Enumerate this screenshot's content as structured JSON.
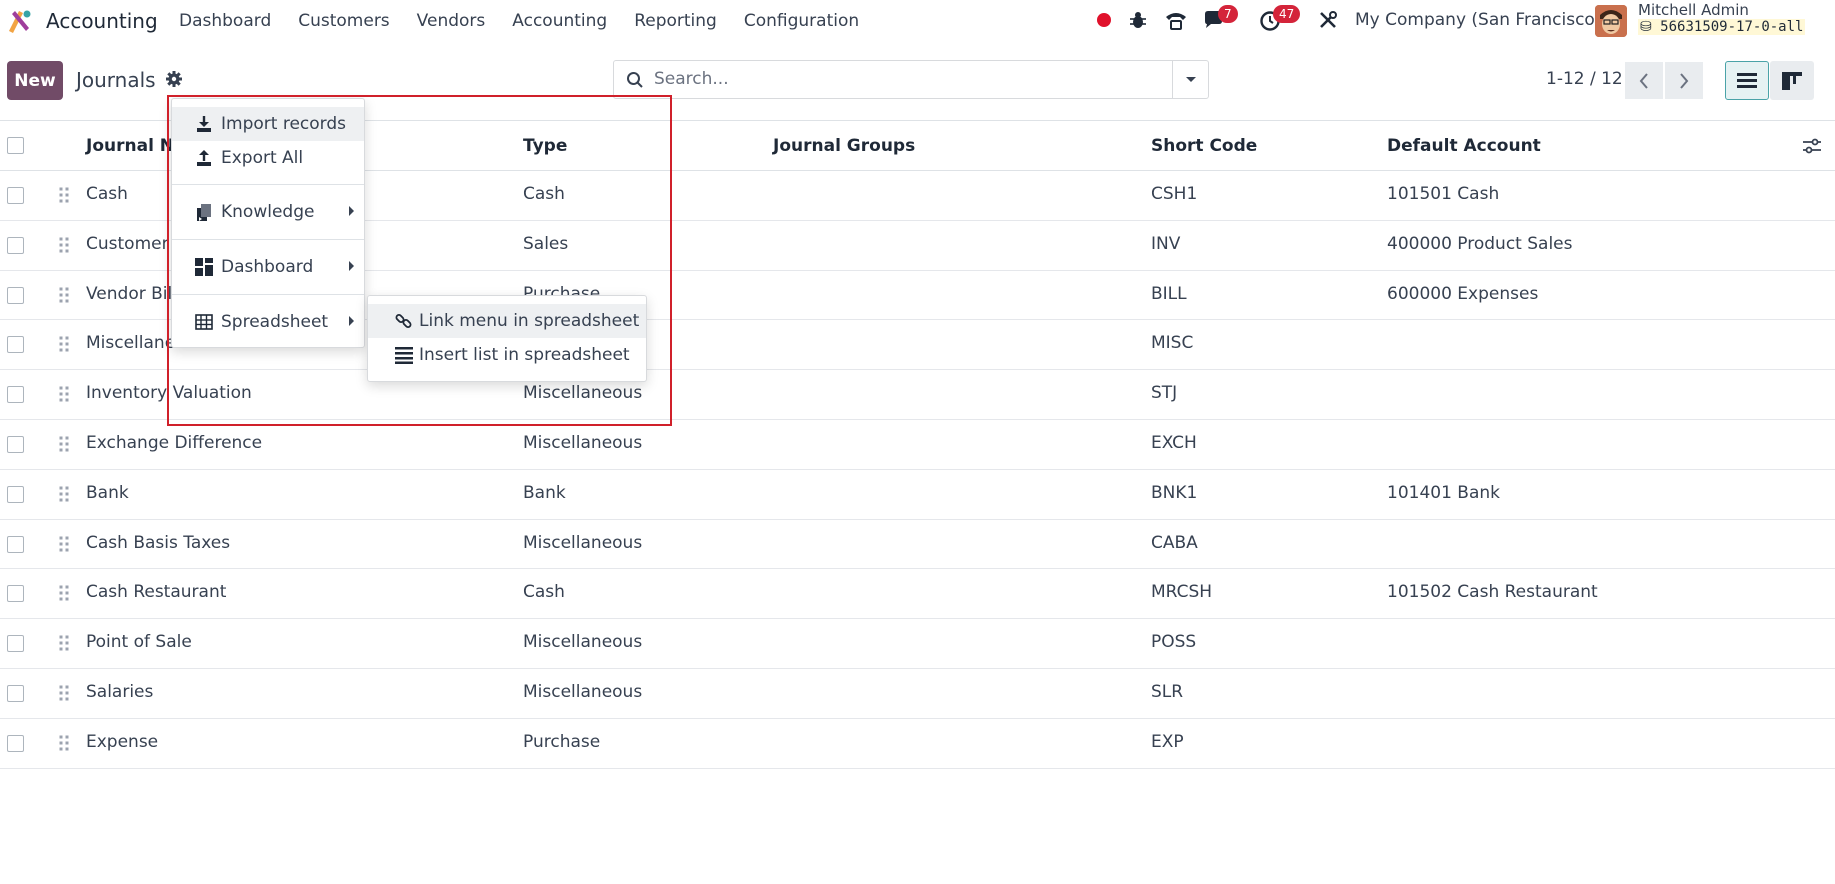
{
  "navbar": {
    "app_name": "Accounting",
    "menu": [
      "Dashboard",
      "Customers",
      "Vendors",
      "Accounting",
      "Reporting",
      "Configuration"
    ],
    "messages_badge": "7",
    "activities_badge": "47",
    "company": "My Company (San Francisco)",
    "user_name": "Mitchell Admin",
    "db_name": "56631509-17-0-all"
  },
  "control_panel": {
    "new_label": "New",
    "title": "Journals",
    "search_placeholder": "Search...",
    "pager": "1-12 / 12"
  },
  "table": {
    "columns": [
      "Journal Na",
      "Type",
      "Journal Groups",
      "Short Code",
      "Default Account"
    ],
    "rows": [
      {
        "name": "Cash",
        "type": "Cash",
        "groups": "",
        "code": "CSH1",
        "account": "101501 Cash"
      },
      {
        "name": "Customer",
        "type": "Sales",
        "groups": "",
        "code": "INV",
        "account": "400000 Product Sales"
      },
      {
        "name": "Vendor Bil",
        "type": "Purchase",
        "groups": "",
        "code": "BILL",
        "account": "600000 Expenses"
      },
      {
        "name": "Miscellane",
        "type": "",
        "groups": "",
        "code": "MISC",
        "account": ""
      },
      {
        "name": "Inventory Valuation",
        "type": "Miscellaneous",
        "groups": "",
        "code": "STJ",
        "account": ""
      },
      {
        "name": "Exchange Difference",
        "type": "Miscellaneous",
        "groups": "",
        "code": "EXCH",
        "account": ""
      },
      {
        "name": "Bank",
        "type": "Bank",
        "groups": "",
        "code": "BNK1",
        "account": "101401 Bank"
      },
      {
        "name": "Cash Basis Taxes",
        "type": "Miscellaneous",
        "groups": "",
        "code": "CABA",
        "account": ""
      },
      {
        "name": "Cash Restaurant",
        "type": "Cash",
        "groups": "",
        "code": "MRCSH",
        "account": "101502 Cash Restaurant"
      },
      {
        "name": "Point of Sale",
        "type": "Miscellaneous",
        "groups": "",
        "code": "POSS",
        "account": ""
      },
      {
        "name": "Salaries",
        "type": "Miscellaneous",
        "groups": "",
        "code": "SLR",
        "account": ""
      },
      {
        "name": "Expense",
        "type": "Purchase",
        "groups": "",
        "code": "EXP",
        "account": ""
      }
    ]
  },
  "gear_menu": {
    "import": "Import records",
    "export": "Export All",
    "knowledge": "Knowledge",
    "dashboard": "Dashboard",
    "spreadsheet": "Spreadsheet"
  },
  "spreadsheet_submenu": {
    "link": "Link menu in spreadsheet",
    "insert": "Insert list in spreadsheet"
  },
  "colors": {
    "brand": "#714b67",
    "badge": "#d4243a",
    "highlight": "#d0202a"
  }
}
